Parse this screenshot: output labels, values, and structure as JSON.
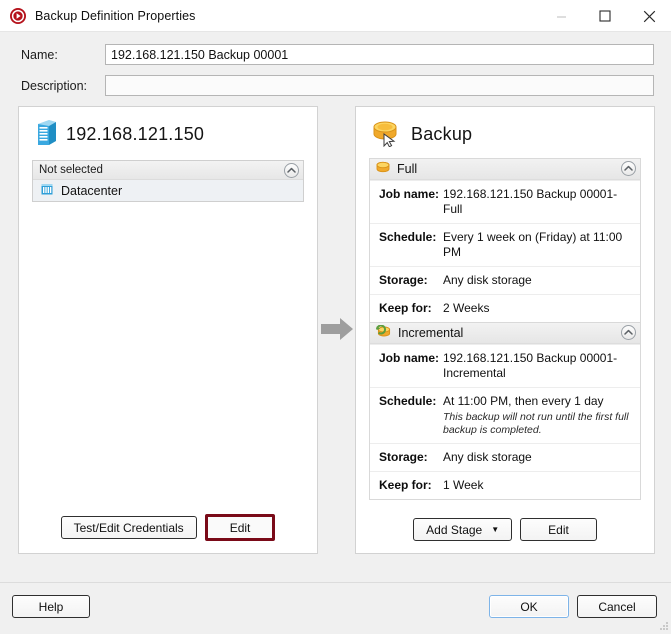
{
  "window": {
    "title": "Backup Definition Properties",
    "app_icon": "record-circle-icon",
    "minimize_label": "Minimize",
    "maximize_label": "Maximize",
    "close_label": "Close"
  },
  "form": {
    "name_label": "Name:",
    "name_value": "192.168.121.150 Backup 00001",
    "description_label": "Description:",
    "description_value": "",
    "description_placeholder": ""
  },
  "source_panel": {
    "icon": "server-icon",
    "title": "192.168.121.150",
    "list_header": "Not selected",
    "items": [
      {
        "icon": "datacenter-icon",
        "label": "Datacenter"
      }
    ],
    "buttons": {
      "credentials": "Test/Edit Credentials",
      "edit": "Edit"
    }
  },
  "flow_arrow": "arrow-right-icon",
  "target_panel": {
    "icon": "database-cursor-icon",
    "title": "Backup",
    "stages": [
      {
        "icon": "full-backup-icon",
        "name": "Full",
        "rows": [
          {
            "key": "Job name:",
            "value": "192.168.121.150 Backup 00001-Full"
          },
          {
            "key": "Schedule:",
            "value": "Every 1 week on (Friday) at 11:00 PM"
          },
          {
            "key": "Storage:",
            "value": "Any disk storage"
          },
          {
            "key": "Keep for:",
            "value": "2 Weeks"
          }
        ]
      },
      {
        "icon": "incremental-backup-icon",
        "name": "Incremental",
        "rows": [
          {
            "key": "Job name:",
            "value": "192.168.121.150 Backup 00001-Incremental"
          },
          {
            "key": "Schedule:",
            "value": "At 11:00 PM, then every 1 day",
            "note": "This backup will not run until the first full backup is completed."
          },
          {
            "key": "Storage:",
            "value": "Any disk storage"
          },
          {
            "key": "Keep for:",
            "value": "1 Week"
          }
        ]
      }
    ],
    "buttons": {
      "add_stage": "Add Stage",
      "edit": "Edit"
    }
  },
  "footer": {
    "help": "Help",
    "ok": "OK",
    "cancel": "Cancel"
  },
  "colors": {
    "highlight_border": "#7a0a18",
    "focus_border": "#7eb4e8",
    "app_icon": "#b5121b",
    "accent_blue": "#2f9fd8",
    "accent_orange": "#f0a92b"
  }
}
